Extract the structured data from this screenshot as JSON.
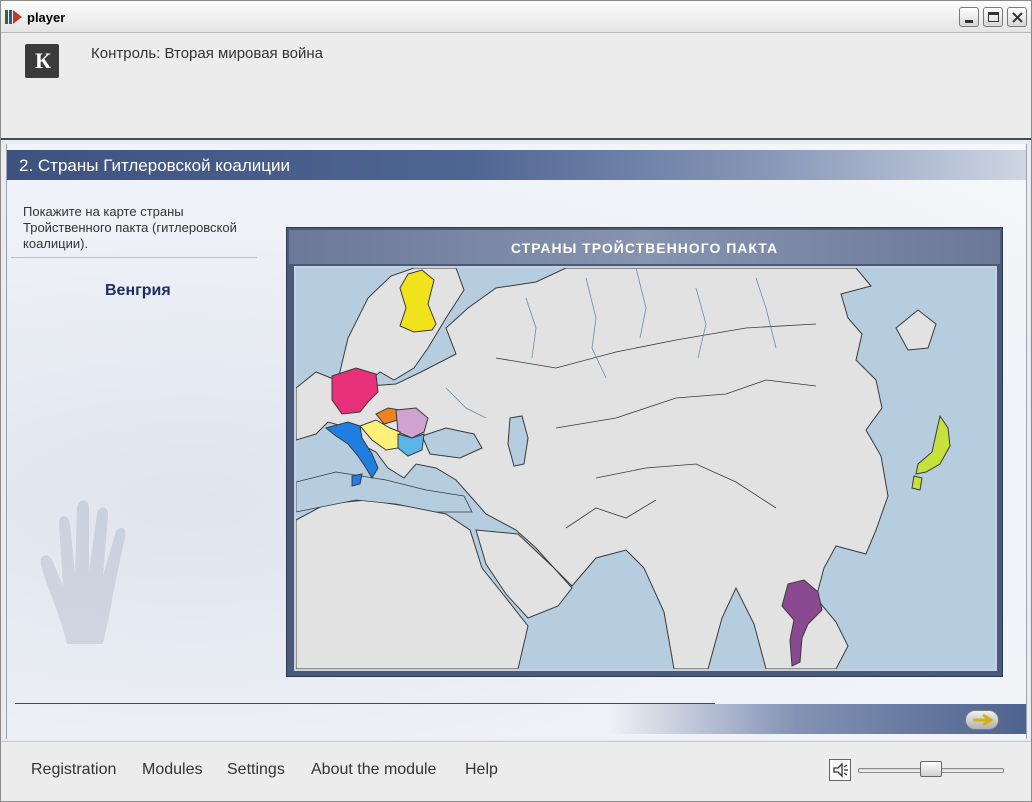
{
  "window": {
    "title": "player",
    "icon": "player-app-icon",
    "controls": [
      "minimize-icon",
      "maximize-icon",
      "close-icon"
    ]
  },
  "header": {
    "logo_letter": "К",
    "course_title": "Контроль: Вторая мировая война"
  },
  "section": {
    "title": "2. Страны Гитлеровской коалиции"
  },
  "task": {
    "instruction": "Покажите на карте страны Тройственного пакта (гитлеровской коалиции).",
    "country": "Венгрия"
  },
  "map": {
    "title": "СТРАНЫ ТРОЙСТВЕННОГО ПАКТА",
    "colors": {
      "sea": "#b6cde0",
      "land": "#e2e2e2",
      "border": "#3a3a3a",
      "finland": "#f2e21c",
      "germany": "#e8307a",
      "italy": "#1f7fe0",
      "hungary": "#cfa2cf",
      "slovakia": "#f0821e",
      "croatia": "#fff07a",
      "romania_bulgaria": "#5bb6e8",
      "japan": "#c6e03c",
      "thailand": "#8a4a92"
    }
  },
  "navigation": {
    "next_icon": "arrow-right-icon"
  },
  "footer": {
    "menu": [
      "Registration",
      "Modules",
      "Settings",
      "About the module",
      "Help"
    ],
    "speaker_icon": "speaker-icon",
    "volume": 0.5
  }
}
